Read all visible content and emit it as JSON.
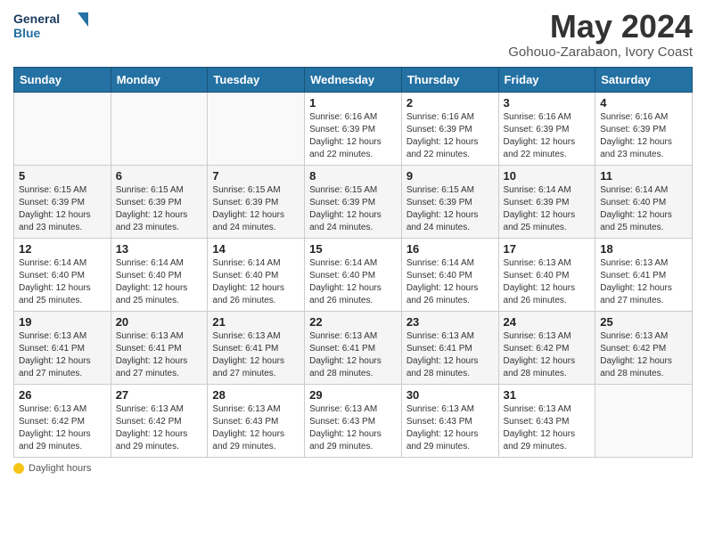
{
  "header": {
    "logo_line1": "General",
    "logo_line2": "Blue",
    "month": "May 2024",
    "location": "Gohouo-Zarabaon, Ivory Coast"
  },
  "days_of_week": [
    "Sunday",
    "Monday",
    "Tuesday",
    "Wednesday",
    "Thursday",
    "Friday",
    "Saturday"
  ],
  "weeks": [
    {
      "days": [
        {
          "num": "",
          "info": ""
        },
        {
          "num": "",
          "info": ""
        },
        {
          "num": "",
          "info": ""
        },
        {
          "num": "1",
          "info": "Sunrise: 6:16 AM\nSunset: 6:39 PM\nDaylight: 12 hours\nand 22 minutes."
        },
        {
          "num": "2",
          "info": "Sunrise: 6:16 AM\nSunset: 6:39 PM\nDaylight: 12 hours\nand 22 minutes."
        },
        {
          "num": "3",
          "info": "Sunrise: 6:16 AM\nSunset: 6:39 PM\nDaylight: 12 hours\nand 22 minutes."
        },
        {
          "num": "4",
          "info": "Sunrise: 6:16 AM\nSunset: 6:39 PM\nDaylight: 12 hours\nand 23 minutes."
        }
      ]
    },
    {
      "days": [
        {
          "num": "5",
          "info": "Sunrise: 6:15 AM\nSunset: 6:39 PM\nDaylight: 12 hours\nand 23 minutes."
        },
        {
          "num": "6",
          "info": "Sunrise: 6:15 AM\nSunset: 6:39 PM\nDaylight: 12 hours\nand 23 minutes."
        },
        {
          "num": "7",
          "info": "Sunrise: 6:15 AM\nSunset: 6:39 PM\nDaylight: 12 hours\nand 24 minutes."
        },
        {
          "num": "8",
          "info": "Sunrise: 6:15 AM\nSunset: 6:39 PM\nDaylight: 12 hours\nand 24 minutes."
        },
        {
          "num": "9",
          "info": "Sunrise: 6:15 AM\nSunset: 6:39 PM\nDaylight: 12 hours\nand 24 minutes."
        },
        {
          "num": "10",
          "info": "Sunrise: 6:14 AM\nSunset: 6:39 PM\nDaylight: 12 hours\nand 25 minutes."
        },
        {
          "num": "11",
          "info": "Sunrise: 6:14 AM\nSunset: 6:40 PM\nDaylight: 12 hours\nand 25 minutes."
        }
      ]
    },
    {
      "days": [
        {
          "num": "12",
          "info": "Sunrise: 6:14 AM\nSunset: 6:40 PM\nDaylight: 12 hours\nand 25 minutes."
        },
        {
          "num": "13",
          "info": "Sunrise: 6:14 AM\nSunset: 6:40 PM\nDaylight: 12 hours\nand 25 minutes."
        },
        {
          "num": "14",
          "info": "Sunrise: 6:14 AM\nSunset: 6:40 PM\nDaylight: 12 hours\nand 26 minutes."
        },
        {
          "num": "15",
          "info": "Sunrise: 6:14 AM\nSunset: 6:40 PM\nDaylight: 12 hours\nand 26 minutes."
        },
        {
          "num": "16",
          "info": "Sunrise: 6:14 AM\nSunset: 6:40 PM\nDaylight: 12 hours\nand 26 minutes."
        },
        {
          "num": "17",
          "info": "Sunrise: 6:13 AM\nSunset: 6:40 PM\nDaylight: 12 hours\nand 26 minutes."
        },
        {
          "num": "18",
          "info": "Sunrise: 6:13 AM\nSunset: 6:41 PM\nDaylight: 12 hours\nand 27 minutes."
        }
      ]
    },
    {
      "days": [
        {
          "num": "19",
          "info": "Sunrise: 6:13 AM\nSunset: 6:41 PM\nDaylight: 12 hours\nand 27 minutes."
        },
        {
          "num": "20",
          "info": "Sunrise: 6:13 AM\nSunset: 6:41 PM\nDaylight: 12 hours\nand 27 minutes."
        },
        {
          "num": "21",
          "info": "Sunrise: 6:13 AM\nSunset: 6:41 PM\nDaylight: 12 hours\nand 27 minutes."
        },
        {
          "num": "22",
          "info": "Sunrise: 6:13 AM\nSunset: 6:41 PM\nDaylight: 12 hours\nand 28 minutes."
        },
        {
          "num": "23",
          "info": "Sunrise: 6:13 AM\nSunset: 6:41 PM\nDaylight: 12 hours\nand 28 minutes."
        },
        {
          "num": "24",
          "info": "Sunrise: 6:13 AM\nSunset: 6:42 PM\nDaylight: 12 hours\nand 28 minutes."
        },
        {
          "num": "25",
          "info": "Sunrise: 6:13 AM\nSunset: 6:42 PM\nDaylight: 12 hours\nand 28 minutes."
        }
      ]
    },
    {
      "days": [
        {
          "num": "26",
          "info": "Sunrise: 6:13 AM\nSunset: 6:42 PM\nDaylight: 12 hours\nand 29 minutes."
        },
        {
          "num": "27",
          "info": "Sunrise: 6:13 AM\nSunset: 6:42 PM\nDaylight: 12 hours\nand 29 minutes."
        },
        {
          "num": "28",
          "info": "Sunrise: 6:13 AM\nSunset: 6:43 PM\nDaylight: 12 hours\nand 29 minutes."
        },
        {
          "num": "29",
          "info": "Sunrise: 6:13 AM\nSunset: 6:43 PM\nDaylight: 12 hours\nand 29 minutes."
        },
        {
          "num": "30",
          "info": "Sunrise: 6:13 AM\nSunset: 6:43 PM\nDaylight: 12 hours\nand 29 minutes."
        },
        {
          "num": "31",
          "info": "Sunrise: 6:13 AM\nSunset: 6:43 PM\nDaylight: 12 hours\nand 29 minutes."
        },
        {
          "num": "",
          "info": ""
        }
      ]
    }
  ],
  "footer": {
    "daylight_label": "Daylight hours"
  }
}
